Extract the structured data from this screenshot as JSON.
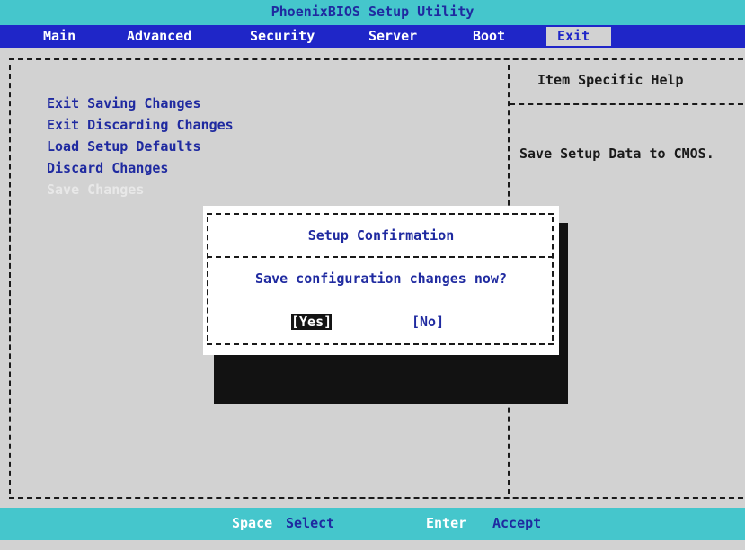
{
  "title": "PhoenixBIOS Setup Utility",
  "menu": [
    "Main",
    "Advanced",
    "Security",
    "Server",
    "Boot",
    "Exit"
  ],
  "active_menu": "Exit",
  "options": [
    "Exit Saving Changes",
    "Exit Discarding Changes",
    "Load Setup Defaults",
    "Discard Changes",
    "Save Changes"
  ],
  "help": {
    "title": "Item Specific Help",
    "text": "Save Setup Data to CMOS."
  },
  "dialog": {
    "title": "Setup Confirmation",
    "message": "Save configuration changes now?",
    "yes_label": "[Yes]",
    "no_label": "[No]",
    "selected": "Yes"
  },
  "status": {
    "key1": "Space",
    "desc1": "Select",
    "key2": "Enter",
    "desc2": "Accept"
  },
  "colors": {
    "menubar": "#1f26c8",
    "titlebar": "#45c6cc",
    "background": "#d2d2d2",
    "text_blue": "#1f2aa0"
  }
}
